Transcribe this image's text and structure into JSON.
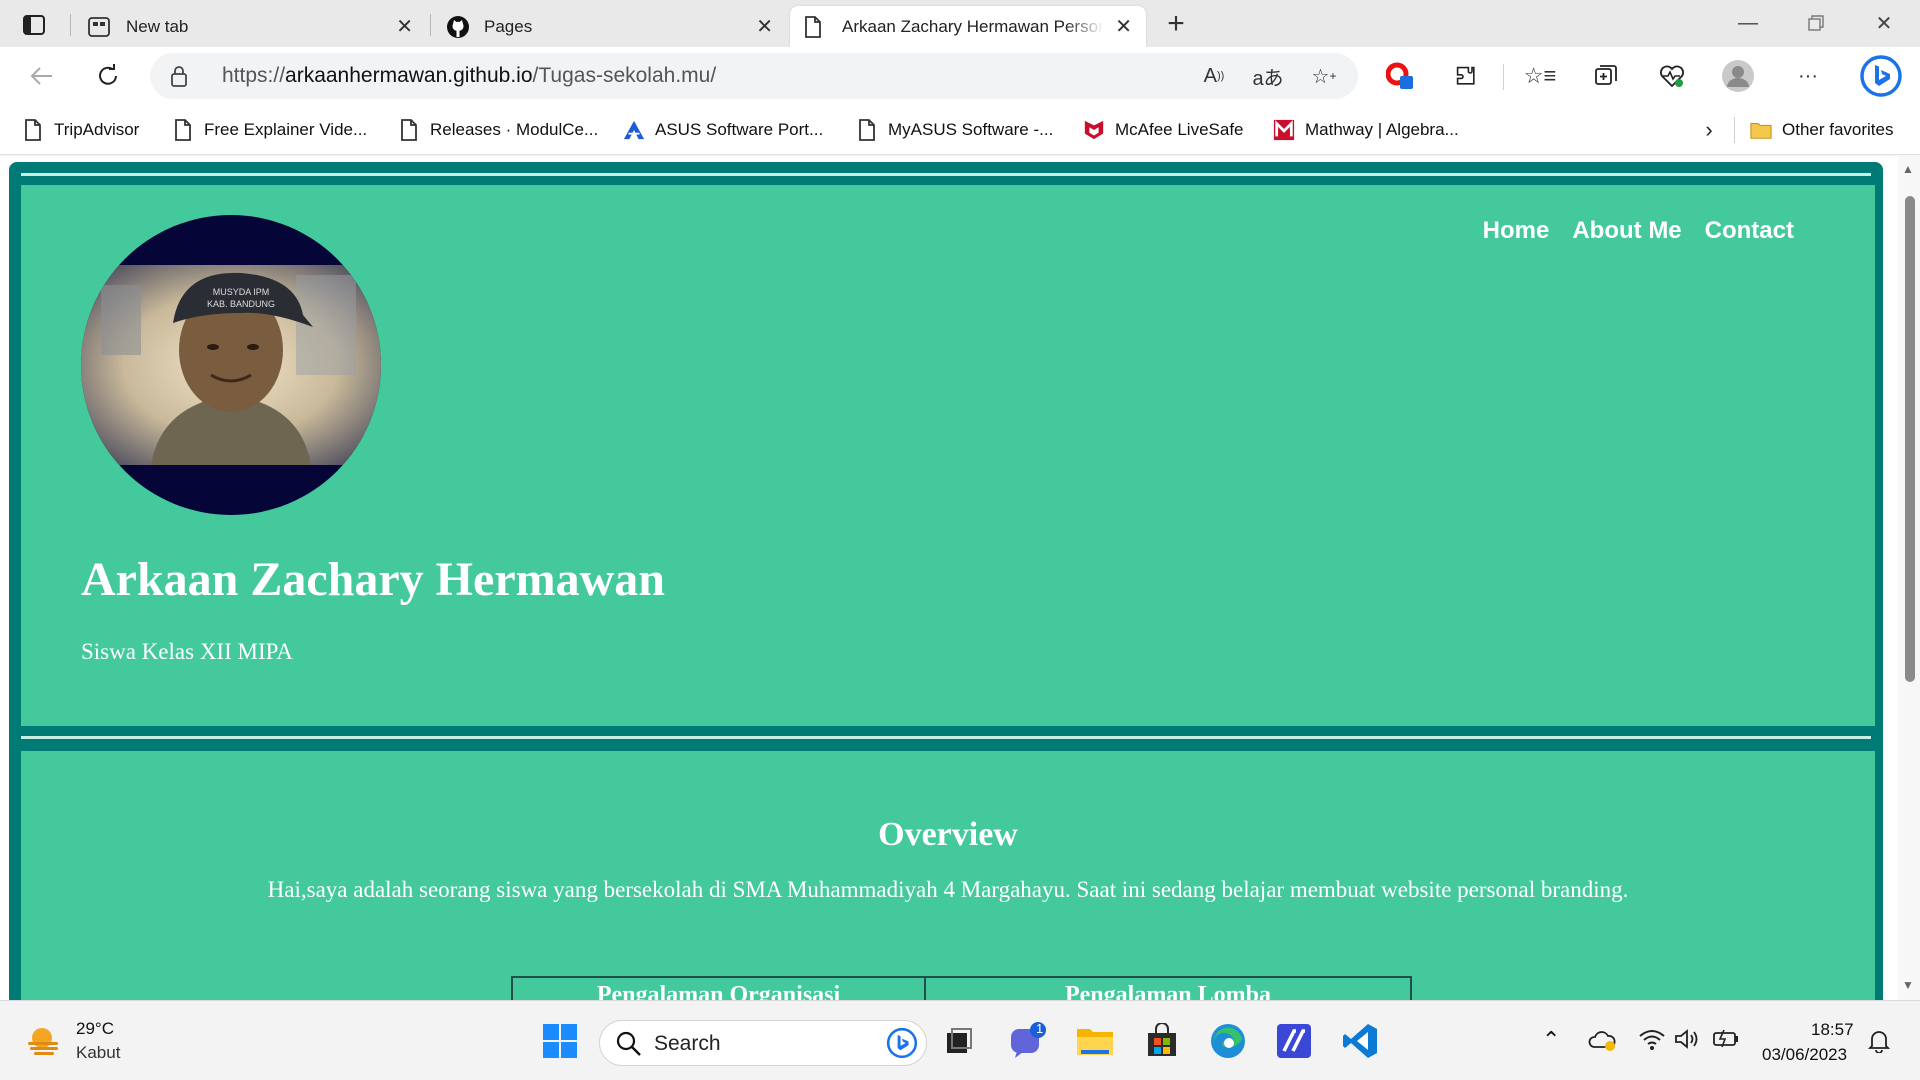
{
  "browser": {
    "tabs": [
      {
        "label": "New tab",
        "icon": "new-tab-icon"
      },
      {
        "label": "Pages",
        "icon": "github-icon"
      },
      {
        "label": "Arkaan Zachary Hermawan Personal Branding",
        "icon": "page-icon",
        "active": true
      }
    ],
    "url_prefix": "https://",
    "url_domain": "arkaanhermawan.github.io",
    "url_path": "/Tugas-sekolah.mu/",
    "favorites": [
      {
        "label": "TripAdvisor",
        "icon": "page-icon"
      },
      {
        "label": "Free Explainer Vide...",
        "icon": "page-icon"
      },
      {
        "label": "Releases · ModulCe...",
        "icon": "page-icon"
      },
      {
        "label": "ASUS Software Port...",
        "icon": "asus-icon"
      },
      {
        "label": "MyASUS Software -...",
        "icon": "page-icon"
      },
      {
        "label": "McAfee LiveSafe",
        "icon": "mcafee-icon"
      },
      {
        "label": "Mathway | Algebra...",
        "icon": "mathway-icon"
      }
    ],
    "other_favorites": "Other favorites"
  },
  "page": {
    "nav": [
      "Home",
      "About Me",
      "Contact"
    ],
    "name": "Arkaan Zachary Hermawan",
    "tagline": "Siswa Kelas XII MIPA",
    "overview_title": "Overview",
    "overview_text": "Hai,saya adalah seorang siswa yang bersekolah di SMA Muhammadiyah 4 Margahayu. Saat ini sedang belajar membuat website personal branding.",
    "table_headers": [
      "Pengalaman Organisasi",
      "Pengalaman Lomba"
    ],
    "cap_text": [
      "MUSYDA IPM",
      "KAB. BANDUNG"
    ]
  },
  "taskbar": {
    "weather_temp": "29°C",
    "weather_desc": "Kabut",
    "search_label": "Search",
    "chat_badge": "1",
    "time": "18:57",
    "date": "03/06/2023"
  },
  "colors": {
    "accent_green": "#43c99c",
    "frame_teal": "#007a74",
    "avatar_navy": "#050538"
  }
}
